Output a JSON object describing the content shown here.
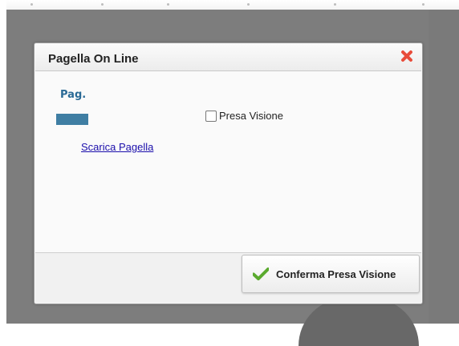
{
  "dialog": {
    "title": "Pagella On Line"
  },
  "content": {
    "icon_text": "Pag.",
    "download_link": "Scarica Pagella",
    "acknowledge_label": "Presa Visione"
  },
  "footer": {
    "confirm_label": "Conferma Presa Visione"
  },
  "colors": {
    "close_icon": "#e84c3a",
    "check_icon": "#5aaa2e",
    "link": "#1a0dab",
    "icon_blue": "#3f7ea3"
  },
  "icons": {
    "close": "close-icon",
    "check": "check-icon",
    "report": "report-card-icon"
  }
}
